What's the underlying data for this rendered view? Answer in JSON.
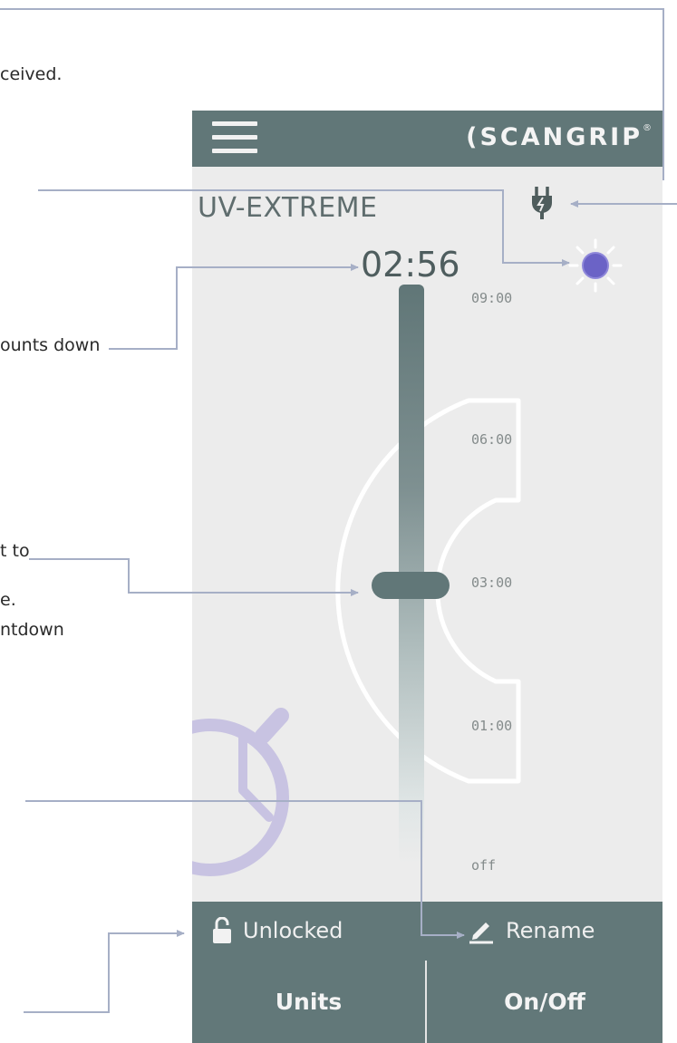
{
  "doc": {
    "snippets": [
      "ceived.",
      "ounts down",
      "t to",
      "e.",
      "ntdown"
    ]
  },
  "app": {
    "brand": "SCANGRIP",
    "brand_mark": "®",
    "device_name": "UV-EXTREME",
    "timer": "02:56",
    "slider": {
      "ticks": [
        "09:00",
        "06:00",
        "03:00",
        "01:00",
        "off"
      ],
      "selected": "03:00"
    },
    "status": {
      "power": "plug-icon",
      "light": "uv-light-icon"
    },
    "lock_label": "Unlocked",
    "rename_label": "Rename",
    "buttons": {
      "units": "Units",
      "onoff": "On/Off"
    }
  },
  "colors": {
    "bar": "#617778",
    "panel": "#ececec",
    "accent_uv": "#6b63c6",
    "pointer": "#a6afc6",
    "clock": "#c8c3e2"
  }
}
